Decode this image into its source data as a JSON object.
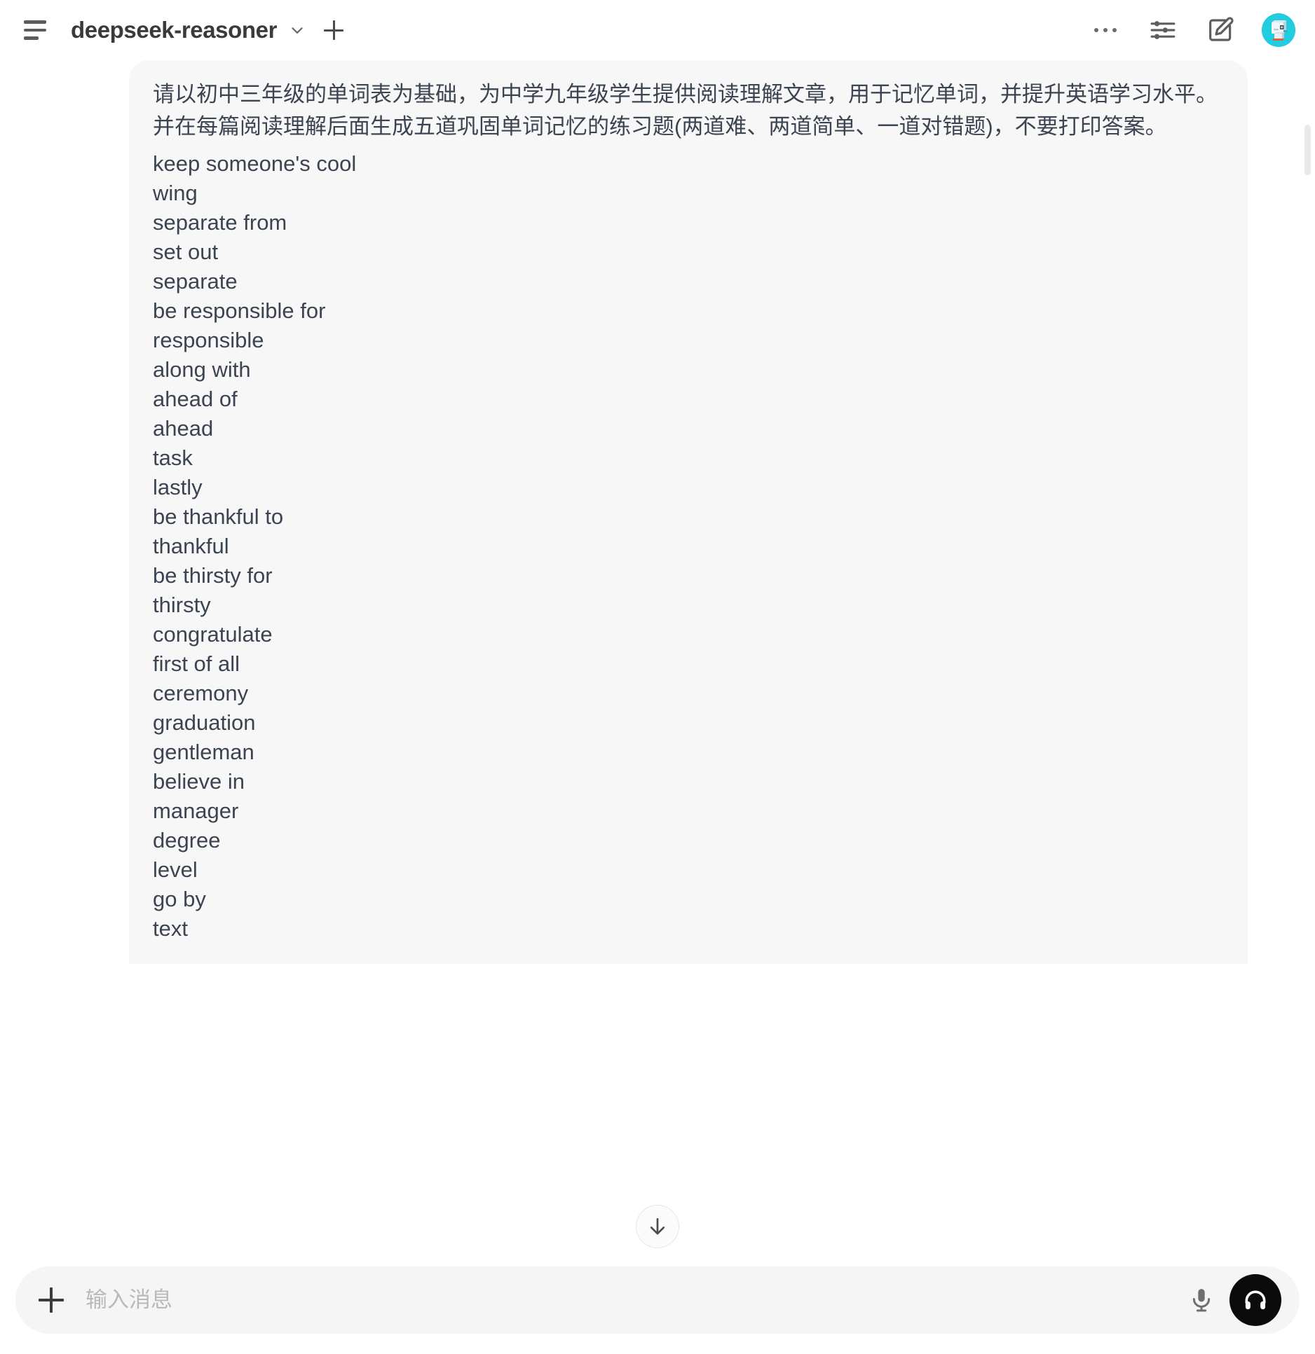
{
  "header": {
    "menu_icon": "hamburger-menu-icon",
    "model_title": "deepseek-reasoner",
    "model_dropdown_icon": "chevron-down-icon",
    "new_chat_icon": "plus-icon",
    "more_icon": "ellipsis-icon",
    "settings_icon": "sliders-icon",
    "compose_icon": "compose-edit-icon",
    "avatar_icon": "robot-avatar",
    "accent_avatar_color": "#22cde0"
  },
  "message": {
    "prompt": "请以初中三年级的单词表为基础，为中学九年级学生提供阅读理解文章，用于记忆单词，并提升英语学习水平。并在每篇阅读理解后面生成五道巩固单词记忆的练习题(两道难、两道简单、一道对错题)，不要打印答案。",
    "words": [
      "keep someone's cool",
      "wing",
      "separate from",
      "set out",
      "separate",
      "be responsible for",
      "responsible",
      "along with",
      "ahead of",
      "ahead",
      "task",
      "lastly",
      "be thankful to",
      "thankful",
      "be thirsty for",
      "thirsty",
      "congratulate",
      "first of all",
      "ceremony",
      "graduation",
      "gentleman",
      "believe in",
      "manager",
      "degree",
      "level",
      "go by",
      "text"
    ],
    "bubble_color": "#f7f7f8",
    "text_color": "#3c4452"
  },
  "scroll_to_bottom": {
    "icon": "arrow-down-icon"
  },
  "composer": {
    "add_icon": "plus-icon",
    "placeholder": "输入消息",
    "value": "",
    "mic_icon": "microphone-icon",
    "voice_icon": "headphones-icon",
    "voice_button_color": "#0b0b0b"
  }
}
